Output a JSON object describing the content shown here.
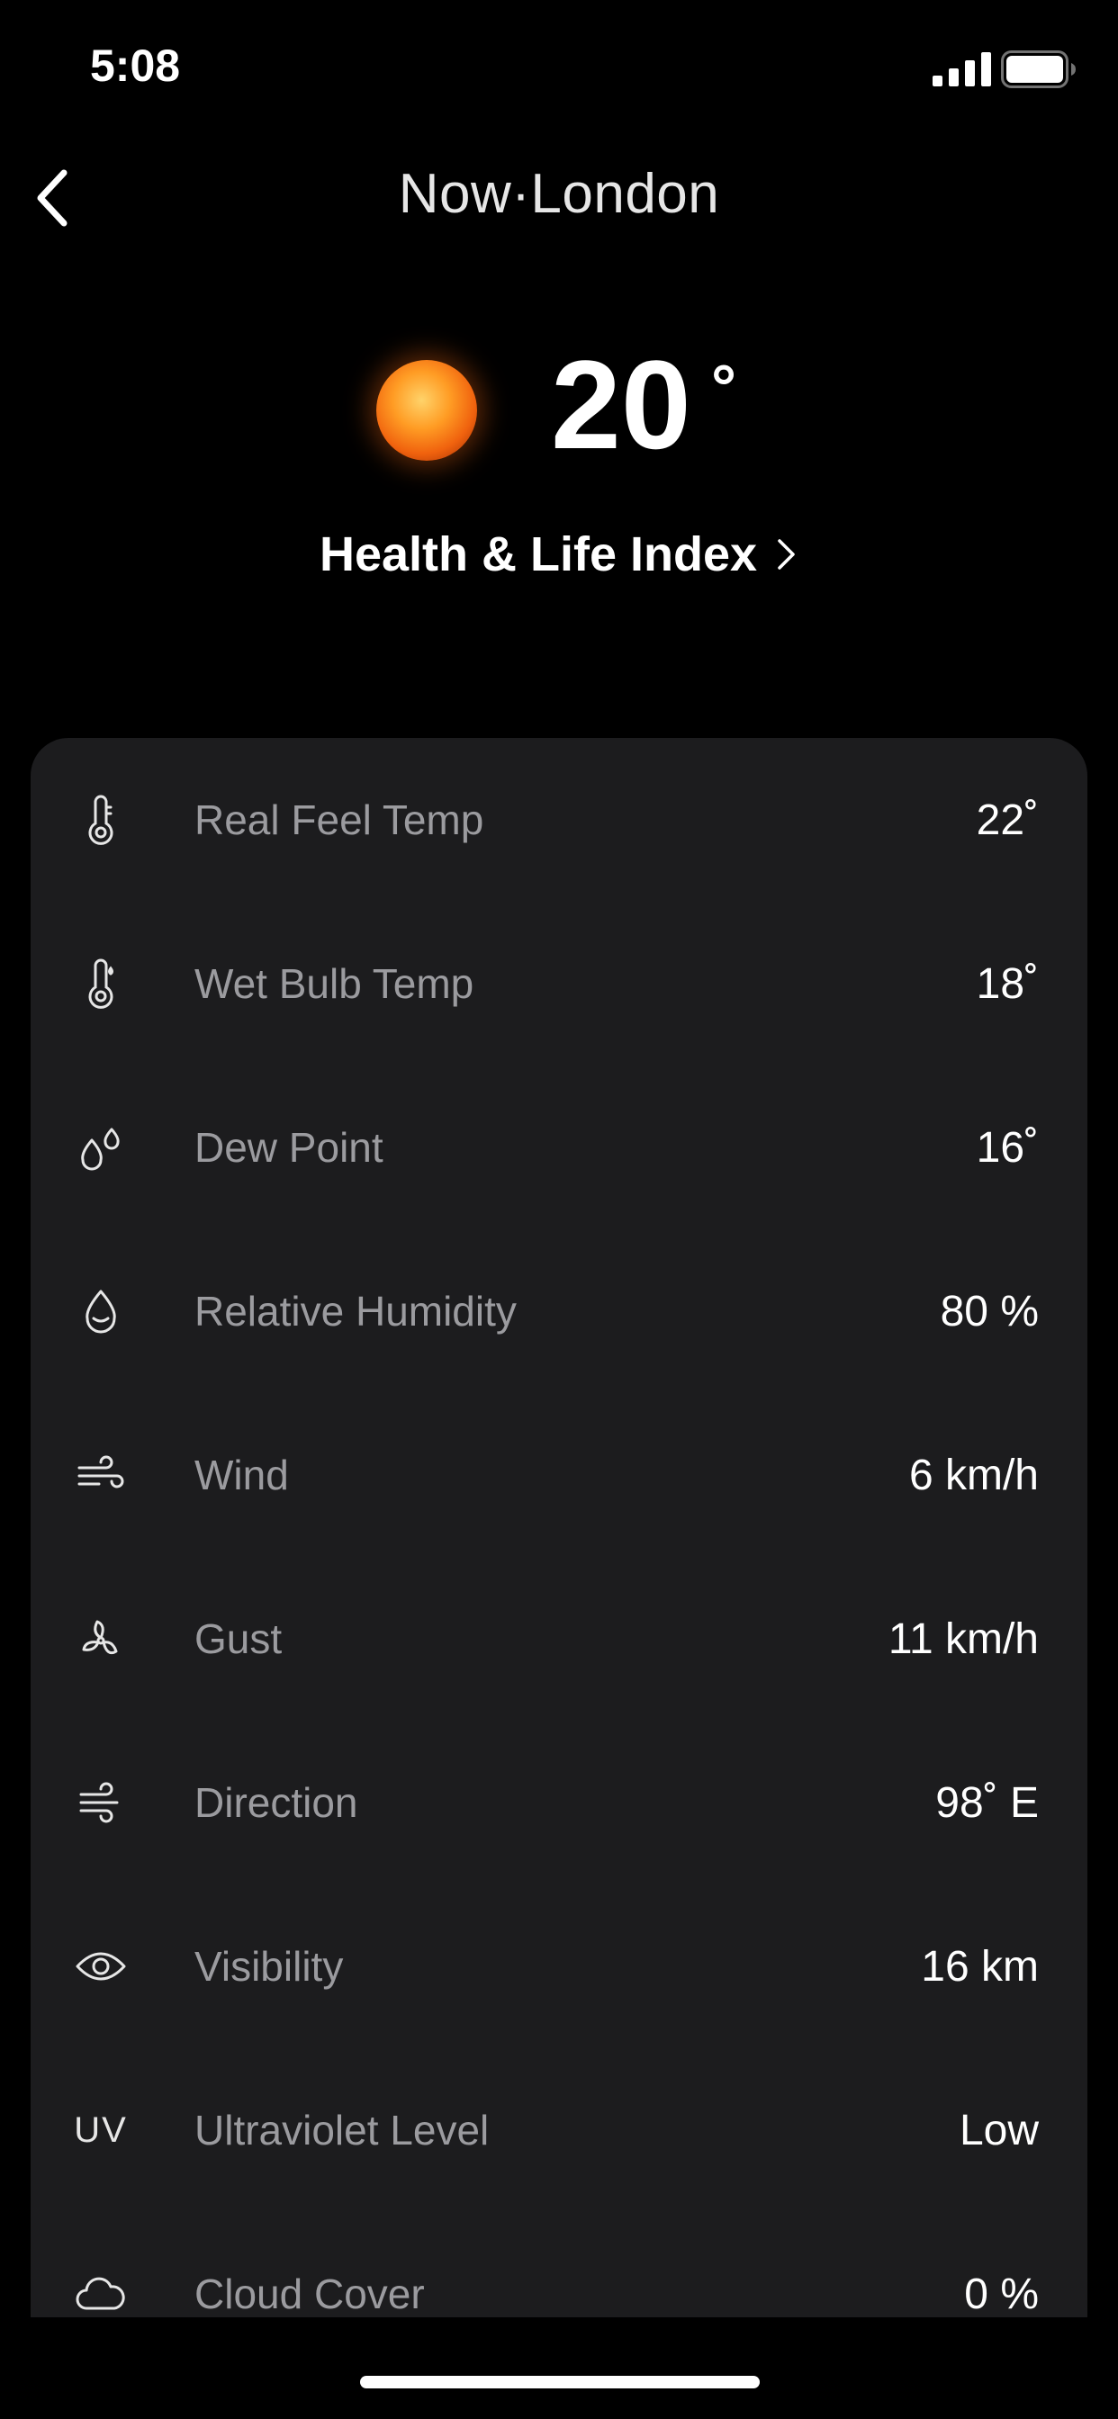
{
  "status_bar": {
    "time": "5:08"
  },
  "header": {
    "title": "Now·London"
  },
  "hero": {
    "temperature": "20",
    "degree_symbol": "°",
    "weather_icon": "sun-icon",
    "health_link_label": "Health & Life Index"
  },
  "details": [
    {
      "icon": "thermometer-icon",
      "label": "Real Feel Temp",
      "value": "22˚"
    },
    {
      "icon": "wet-bulb-thermometer-icon",
      "label": "Wet Bulb Temp",
      "value": "18˚"
    },
    {
      "icon": "dew-point-icon",
      "label": "Dew Point",
      "value": "16˚"
    },
    {
      "icon": "humidity-drop-icon",
      "label": "Relative Humidity",
      "value": "80 %"
    },
    {
      "icon": "wind-icon",
      "label": "Wind",
      "value": "6 km/h"
    },
    {
      "icon": "gust-fan-icon",
      "label": "Gust",
      "value": "11 km/h"
    },
    {
      "icon": "wind-direction-icon",
      "label": "Direction",
      "value": "98˚ E"
    },
    {
      "icon": "eye-icon",
      "label": "Visibility",
      "value": "16 km"
    },
    {
      "icon": "uv-icon",
      "icon_text": "UV",
      "label": "Ultraviolet Level",
      "value": "Low"
    },
    {
      "icon": "cloud-icon",
      "label": "Cloud Cover",
      "value": "0 %"
    }
  ],
  "colors": {
    "background": "#000000",
    "card": "#1c1c1e",
    "label": "#9b9b9f",
    "value": "#ffffff",
    "sun": "#f0620e"
  }
}
